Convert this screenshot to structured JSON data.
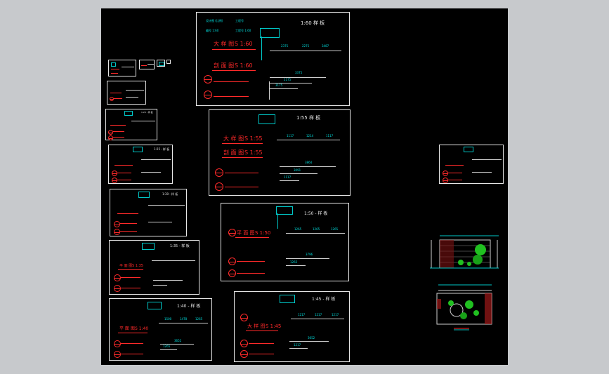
{
  "viewport": {
    "background": "#000000",
    "frame": "#c7c9cc"
  },
  "colors": {
    "line": "#e6e6e6",
    "cyan": "#00e0e0",
    "red": "#ff2a2a",
    "green": "#20c020"
  },
  "sheets": {
    "s60": {
      "title": "1:60 样 板",
      "label1": "大 样 图",
      "scale1": "S 1:60",
      "label2": "剖 面 图",
      "scale2": "S 1:60",
      "dim_a": "2375",
      "dim_b": "2275",
      "dim_c": "3487",
      "dim_d": "3375",
      "dim_e": "2175",
      "dim_f": "3175",
      "tag1": "设计图 (比例)",
      "tag2": "工程号",
      "note1": "编号 1:60",
      "note2": "工程号 1:60"
    },
    "s55": {
      "title": "1:55 样 板",
      "label1": "大 样 图",
      "scale1": "S 1:55",
      "label2": "剖 面 图",
      "scale2": "S 1:55",
      "dim_a": "1117",
      "dim_b": "1214",
      "dim_c": "1117",
      "dim_d": "3864",
      "dim_e": "3091",
      "dim_f": "1117"
    },
    "s50": {
      "title": "1:50 - 样 板",
      "label1": "平 面 图",
      "scale1": "S 1:50",
      "dim_a": "1265",
      "dim_b": "1265",
      "dim_c": "1265",
      "dim_d": "3796",
      "dim_e": "1265"
    },
    "s45": {
      "title": "1:45 - 样 板",
      "label1": "大 样 图",
      "scale1": "S 1:45",
      "dim_a": "1217",
      "dim_b": "1217",
      "dim_c": "1217",
      "dim_d": "3652",
      "dim_e": "1217"
    },
    "s40": {
      "title": "1:40 - 样 板",
      "label1": "平 面 图",
      "scale1": "S 1:40",
      "dim_a": "1500",
      "dim_b": "1478",
      "dim_c": "1265",
      "dim_d": "3652",
      "dim_e": "1265"
    },
    "s35": {
      "title": "1:35 - 样 板",
      "label1": "平 面 图",
      "scale1": "S 1:35"
    },
    "s30": {
      "title": "1:30 - 样 板"
    },
    "s25": {
      "title": "1:25 - 样 板"
    },
    "s20": {
      "title": "1:20 - 样 板"
    }
  }
}
